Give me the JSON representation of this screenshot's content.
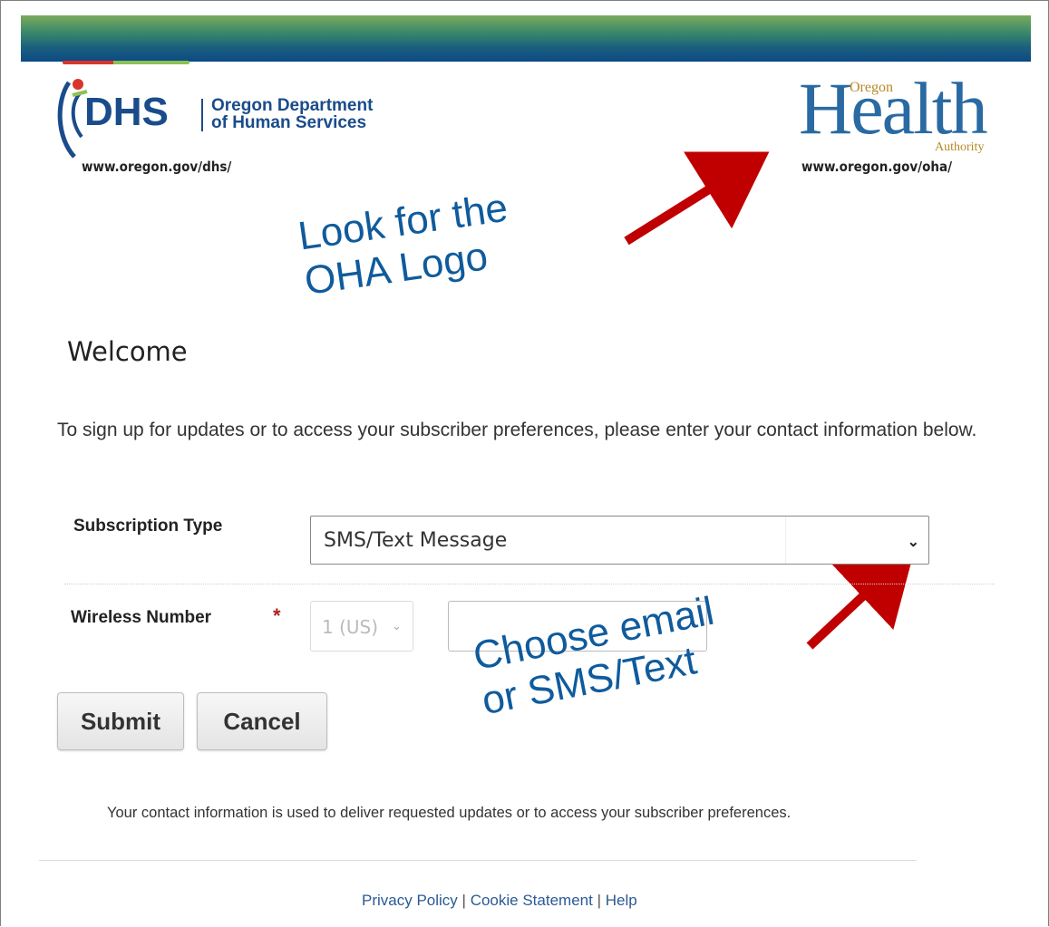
{
  "header": {
    "dhs": {
      "letters": "DHS",
      "name_line1": "Oregon Department",
      "name_line2": "of Human Services",
      "url": "www.oregon.gov/dhs/"
    },
    "oha": {
      "health": "Health",
      "oregon": "Oregon",
      "authority": "Authority",
      "url": "www.oregon.gov/oha/"
    }
  },
  "annotations": {
    "logo_line1": "Look for the",
    "logo_line2": "OHA Logo",
    "choose_line1": "Choose email",
    "choose_line2": "or SMS/Text",
    "arrow_color": "#c00000"
  },
  "main": {
    "title": "Welcome",
    "intro": "To sign up for updates or to access your subscriber preferences, please enter your contact information below."
  },
  "form": {
    "subscription_type_label": "Subscription Type",
    "subscription_type_value": "SMS/Text Message",
    "wireless_number_label": "Wireless Number",
    "required_marker": "*",
    "country_code_value": "1 (US)",
    "phone_value": "",
    "submit_label": "Submit",
    "cancel_label": "Cancel"
  },
  "note": "Your contact information is used to deliver requested updates or to access your subscriber preferences.",
  "footer": {
    "privacy": "Privacy Policy",
    "sep": "|",
    "cookie": "Cookie Statement",
    "help": "Help"
  }
}
